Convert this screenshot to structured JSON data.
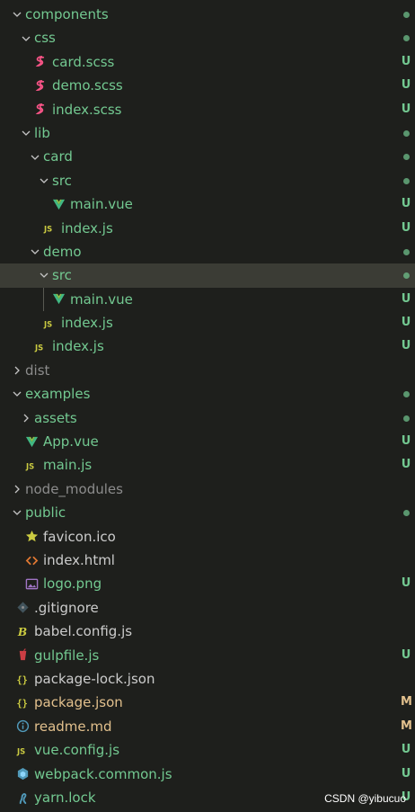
{
  "colors": {
    "untracked": "#73c991",
    "ignored": "#8c8c8c",
    "normal": "#cccccc",
    "modified": "#e2c08d",
    "selected_bg": "#3b3c35"
  },
  "tree": [
    {
      "label": "components",
      "kind": "folder",
      "open": true,
      "depth": 0,
      "color": "untracked",
      "status": "dot"
    },
    {
      "label": "css",
      "kind": "folder",
      "open": true,
      "depth": 1,
      "color": "untracked",
      "status": "dot"
    },
    {
      "label": "card.scss",
      "kind": "file",
      "icon": "sass-icon",
      "depth": 2,
      "color": "untracked",
      "status": "U"
    },
    {
      "label": "demo.scss",
      "kind": "file",
      "icon": "sass-icon",
      "depth": 2,
      "color": "untracked",
      "status": "U"
    },
    {
      "label": "index.scss",
      "kind": "file",
      "icon": "sass-icon",
      "depth": 2,
      "color": "untracked",
      "status": "U"
    },
    {
      "label": "lib",
      "kind": "folder",
      "open": true,
      "depth": 1,
      "color": "untracked",
      "status": "dot"
    },
    {
      "label": "card",
      "kind": "folder",
      "open": true,
      "depth": 2,
      "color": "untracked",
      "status": "dot"
    },
    {
      "label": "src",
      "kind": "folder",
      "open": true,
      "depth": 3,
      "color": "untracked",
      "status": "dot"
    },
    {
      "label": "main.vue",
      "kind": "file",
      "icon": "vue-icon",
      "depth": 4,
      "color": "untracked",
      "status": "U"
    },
    {
      "label": "index.js",
      "kind": "file",
      "icon": "js-icon",
      "depth": 3,
      "color": "untracked",
      "status": "U"
    },
    {
      "label": "demo",
      "kind": "folder",
      "open": true,
      "depth": 2,
      "color": "untracked",
      "status": "dot"
    },
    {
      "label": "src",
      "kind": "folder",
      "open": true,
      "depth": 3,
      "color": "untracked",
      "status": "dot",
      "selected": true
    },
    {
      "label": "main.vue",
      "kind": "file",
      "icon": "vue-icon",
      "depth": 4,
      "color": "untracked",
      "status": "U",
      "guide": true
    },
    {
      "label": "index.js",
      "kind": "file",
      "icon": "js-icon",
      "depth": 3,
      "color": "untracked",
      "status": "U"
    },
    {
      "label": "index.js",
      "kind": "file",
      "icon": "js-icon",
      "depth": 2,
      "color": "untracked",
      "status": "U"
    },
    {
      "label": "dist",
      "kind": "folder",
      "open": false,
      "depth": 0,
      "color": "ignored",
      "status": ""
    },
    {
      "label": "examples",
      "kind": "folder",
      "open": true,
      "depth": 0,
      "color": "untracked",
      "status": "dot"
    },
    {
      "label": "assets",
      "kind": "folder",
      "open": false,
      "depth": 1,
      "color": "untracked",
      "status": "dot"
    },
    {
      "label": "App.vue",
      "kind": "file",
      "icon": "vue-icon",
      "depth": 1,
      "color": "untracked",
      "status": "U"
    },
    {
      "label": "main.js",
      "kind": "file",
      "icon": "js-icon",
      "depth": 1,
      "color": "untracked",
      "status": "U"
    },
    {
      "label": "node_modules",
      "kind": "folder",
      "open": false,
      "depth": 0,
      "color": "ignored",
      "status": ""
    },
    {
      "label": "public",
      "kind": "folder",
      "open": true,
      "depth": 0,
      "color": "untracked",
      "status": "dot"
    },
    {
      "label": "favicon.ico",
      "kind": "file",
      "icon": "star-icon",
      "depth": 1,
      "color": "normal",
      "status": ""
    },
    {
      "label": "index.html",
      "kind": "file",
      "icon": "html-icon",
      "depth": 1,
      "color": "normal",
      "status": ""
    },
    {
      "label": "logo.png",
      "kind": "file",
      "icon": "image-icon",
      "depth": 1,
      "color": "untracked",
      "status": "U"
    },
    {
      "label": ".gitignore",
      "kind": "file",
      "icon": "git-icon",
      "depth": 0,
      "color": "normal",
      "status": ""
    },
    {
      "label": "babel.config.js",
      "kind": "file",
      "icon": "babel-icon",
      "depth": 0,
      "color": "normal",
      "status": ""
    },
    {
      "label": "gulpfile.js",
      "kind": "file",
      "icon": "gulp-icon",
      "depth": 0,
      "color": "untracked",
      "status": "U"
    },
    {
      "label": "package-lock.json",
      "kind": "file",
      "icon": "json-icon",
      "depth": 0,
      "color": "normal",
      "status": ""
    },
    {
      "label": "package.json",
      "kind": "file",
      "icon": "json-icon",
      "depth": 0,
      "color": "modified",
      "status": "M"
    },
    {
      "label": "readme.md",
      "kind": "file",
      "icon": "info-icon",
      "depth": 0,
      "color": "modified",
      "status": "M"
    },
    {
      "label": "vue.config.js",
      "kind": "file",
      "icon": "js-icon",
      "depth": 0,
      "color": "untracked",
      "status": "U"
    },
    {
      "label": "webpack.common.js",
      "kind": "file",
      "icon": "webpack-icon",
      "depth": 0,
      "color": "untracked",
      "status": "U"
    },
    {
      "label": "yarn.lock",
      "kind": "file",
      "icon": "yarn-icon",
      "depth": 0,
      "color": "untracked",
      "status": "U"
    }
  ],
  "watermark": "CSDN @yibucuo"
}
